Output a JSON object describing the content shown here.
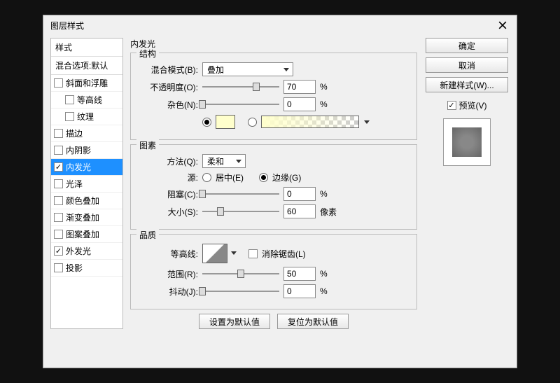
{
  "title": "图层样式",
  "sidebar": {
    "header": "样式",
    "subheader": "混合选项:默认",
    "items": [
      {
        "label": "斜面和浮雕",
        "checked": false
      },
      {
        "label": "等高线",
        "checked": false,
        "indent": true
      },
      {
        "label": "纹理",
        "checked": false,
        "indent": true
      },
      {
        "label": "描边",
        "checked": false
      },
      {
        "label": "内阴影",
        "checked": false
      },
      {
        "label": "内发光",
        "checked": true,
        "selected": true
      },
      {
        "label": "光泽",
        "checked": false
      },
      {
        "label": "颜色叠加",
        "checked": false
      },
      {
        "label": "渐变叠加",
        "checked": false
      },
      {
        "label": "图案叠加",
        "checked": false
      },
      {
        "label": "外发光",
        "checked": true
      },
      {
        "label": "投影",
        "checked": false
      }
    ]
  },
  "panel": {
    "title": "内发光",
    "structure": {
      "legend": "结构",
      "blend_label": "混合模式(B):",
      "blend_value": "叠加",
      "opacity_label": "不透明度(O):",
      "opacity_value": "70",
      "opacity_unit": "%",
      "noise_label": "杂色(N):",
      "noise_value": "0",
      "noise_unit": "%"
    },
    "elements": {
      "legend": "图素",
      "method_label": "方法(Q):",
      "method_value": "柔和",
      "source_label": "源:",
      "source_center": "居中(E)",
      "source_edge": "边缘(G)",
      "choke_label": "阻塞(C):",
      "choke_value": "0",
      "choke_unit": "%",
      "size_label": "大小(S):",
      "size_value": "60",
      "size_unit": "像素"
    },
    "quality": {
      "legend": "品质",
      "contour_label": "等高线:",
      "antialias_label": "消除锯齿(L)",
      "range_label": "范围(R):",
      "range_value": "50",
      "range_unit": "%",
      "jitter_label": "抖动(J):",
      "jitter_value": "0",
      "jitter_unit": "%"
    },
    "reset_default": "设置为默认值",
    "restore_default": "复位为默认值"
  },
  "right": {
    "ok": "确定",
    "cancel": "取消",
    "newstyle": "新建样式(W)...",
    "preview": "预览(V)"
  }
}
